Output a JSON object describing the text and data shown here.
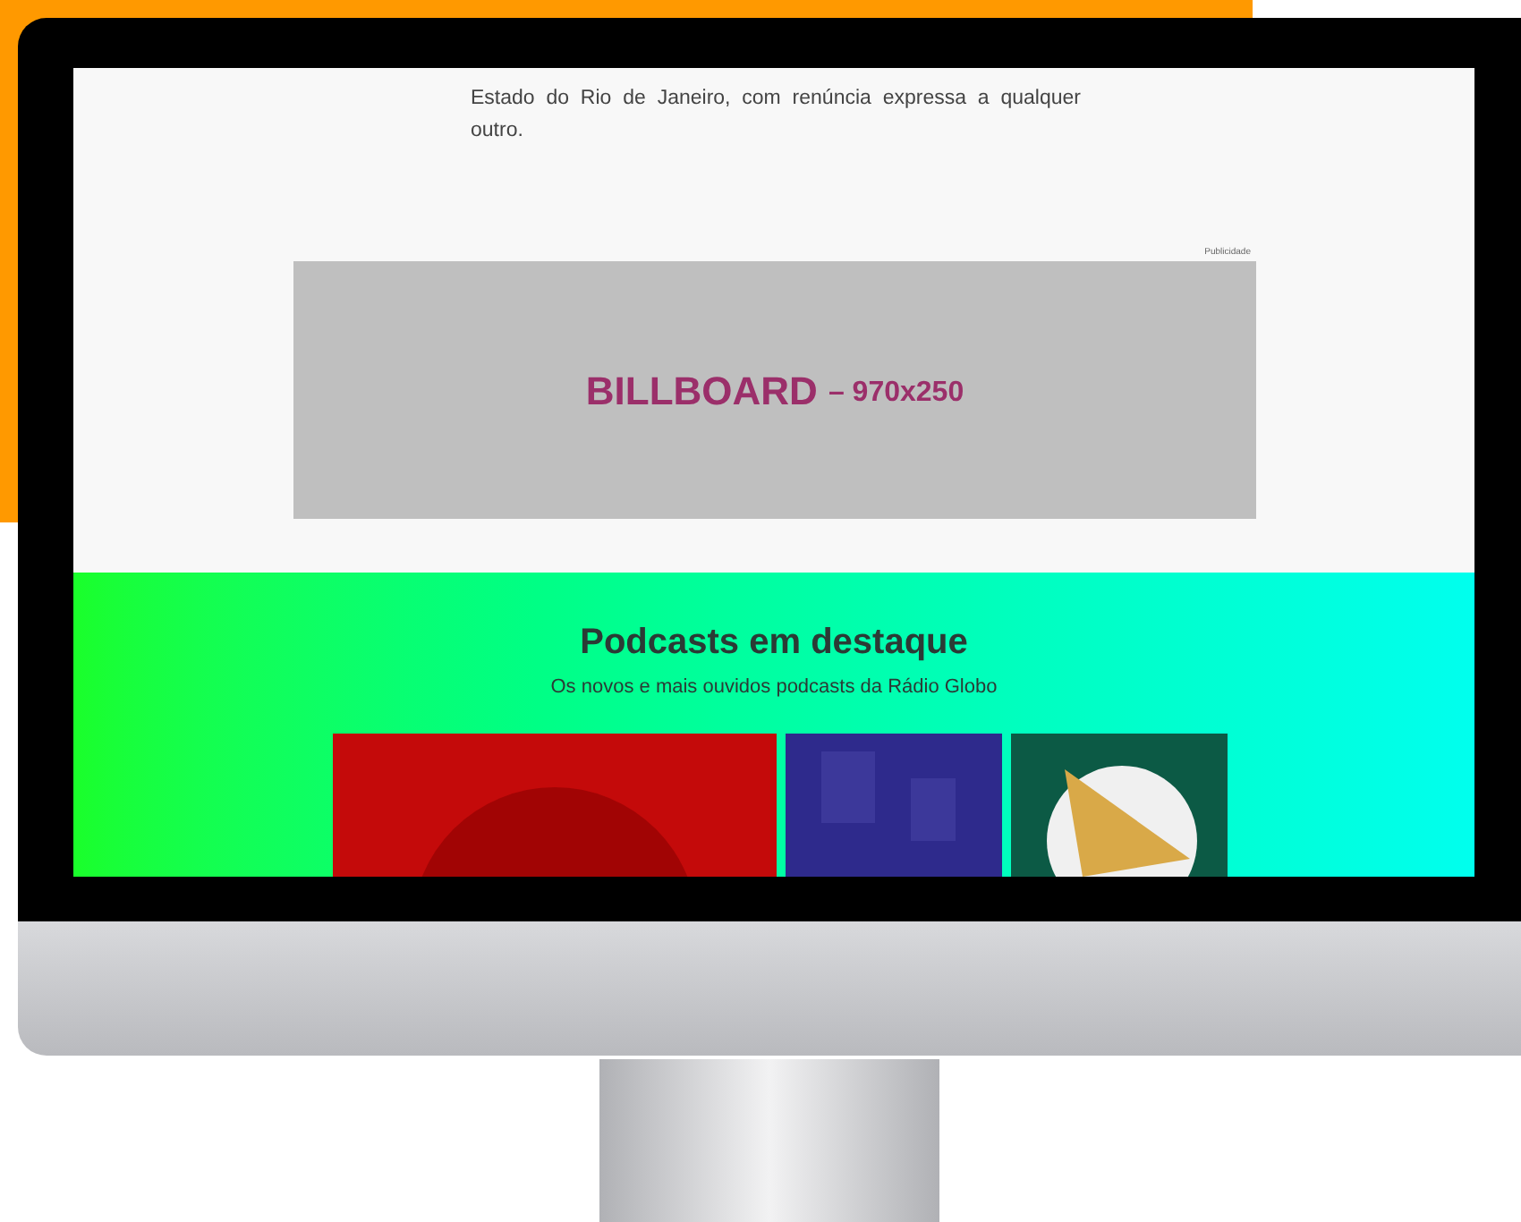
{
  "article": {
    "paragraph": "Estado do Rio de Janeiro, com renúncia expressa a qualquer outro."
  },
  "ad": {
    "label": "Publicidade",
    "title": "BILLBOARD",
    "size": "– 970x250"
  },
  "podcasts": {
    "title": "Podcasts em destaque",
    "subtitle": "Os novos e mais ouvidos podcasts da Rádio Globo",
    "covers": [
      {
        "kind": "rays",
        "color": "#c40a0a"
      },
      {
        "kind": "pattern",
        "color": "#2e2a8c"
      },
      {
        "kind": "circle",
        "color": "#0c5a45"
      }
    ]
  }
}
